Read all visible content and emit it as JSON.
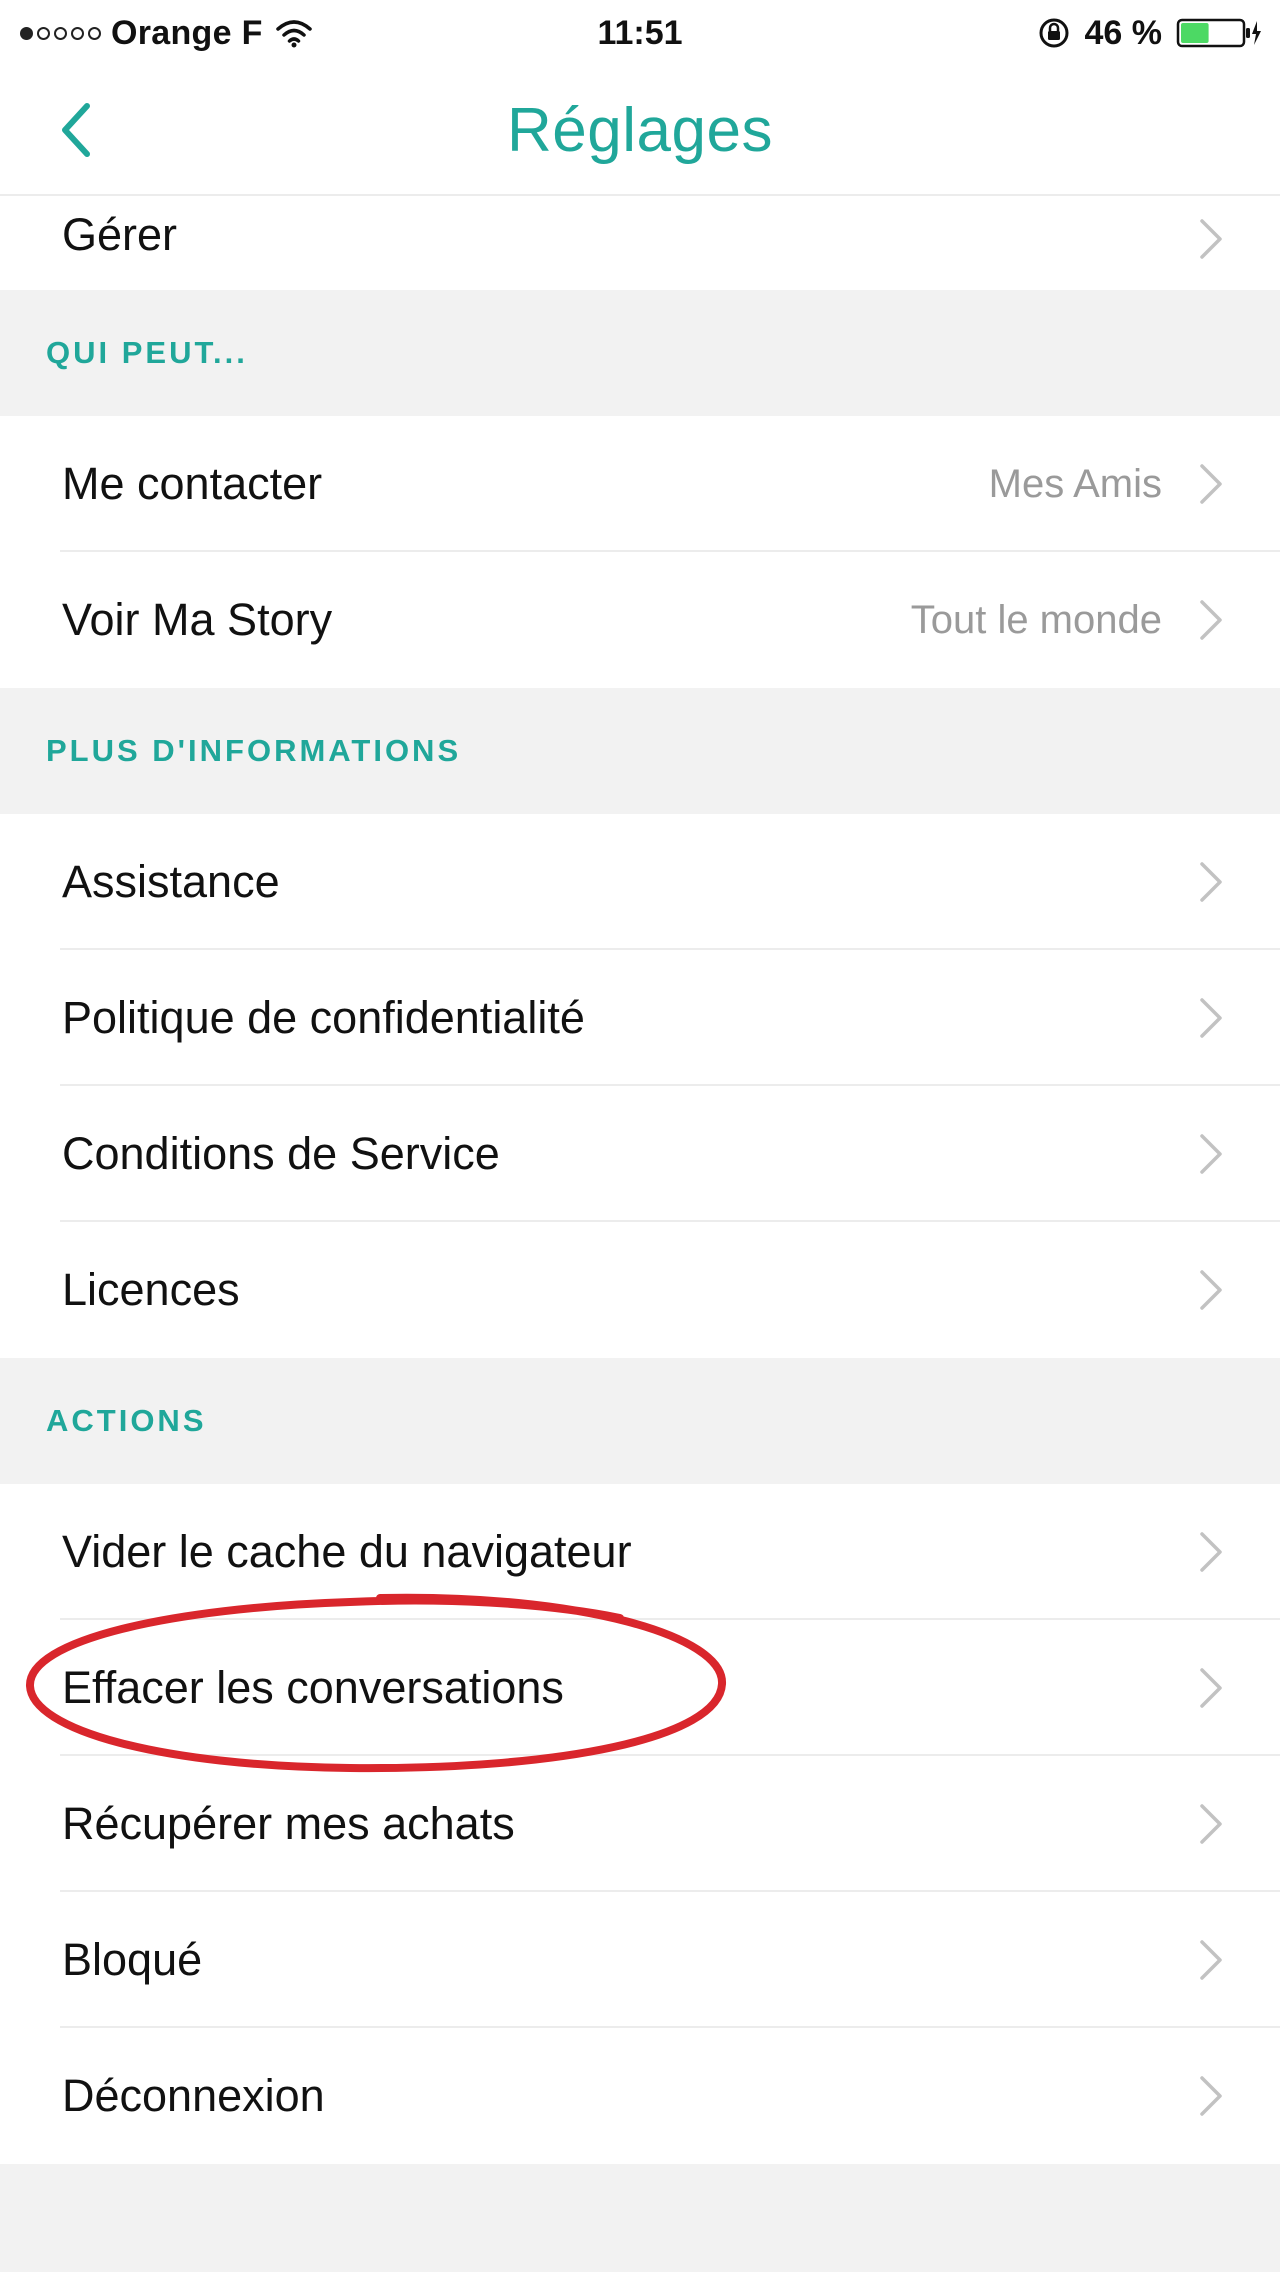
{
  "status_bar": {
    "carrier": "Orange F",
    "signal_bars_filled": 1,
    "signal_bars_total": 5,
    "time": "11:51",
    "battery_percent": "46 %",
    "battery_level": 0.46,
    "battery_color": "#4cd964"
  },
  "nav": {
    "title": "Réglages",
    "back_icon": "chevron-left-icon"
  },
  "colors": {
    "accent": "#20a79a",
    "annotation": "#d9262c"
  },
  "sections": {
    "top": {
      "items": [
        {
          "label": "Gérer"
        }
      ]
    },
    "who_can": {
      "title": "QUI PEUT...",
      "items": [
        {
          "label": "Me contacter",
          "value": "Mes Amis"
        },
        {
          "label": "Voir Ma Story",
          "value": "Tout le monde"
        }
      ]
    },
    "more_info": {
      "title": "PLUS D'INFORMATIONS",
      "items": [
        {
          "label": "Assistance"
        },
        {
          "label": "Politique de confidentialité"
        },
        {
          "label": "Conditions de Service"
        },
        {
          "label": "Licences"
        }
      ]
    },
    "actions": {
      "title": "ACTIONS",
      "items": [
        {
          "label": "Vider le cache du navigateur"
        },
        {
          "label": "Effacer les conversations"
        },
        {
          "label": "Récupérer mes achats"
        },
        {
          "label": "Bloqué"
        },
        {
          "label": "Déconnexion"
        }
      ]
    }
  },
  "annotation": {
    "shape": "ellipse",
    "highlighted_item": "Effacer les conversations"
  }
}
